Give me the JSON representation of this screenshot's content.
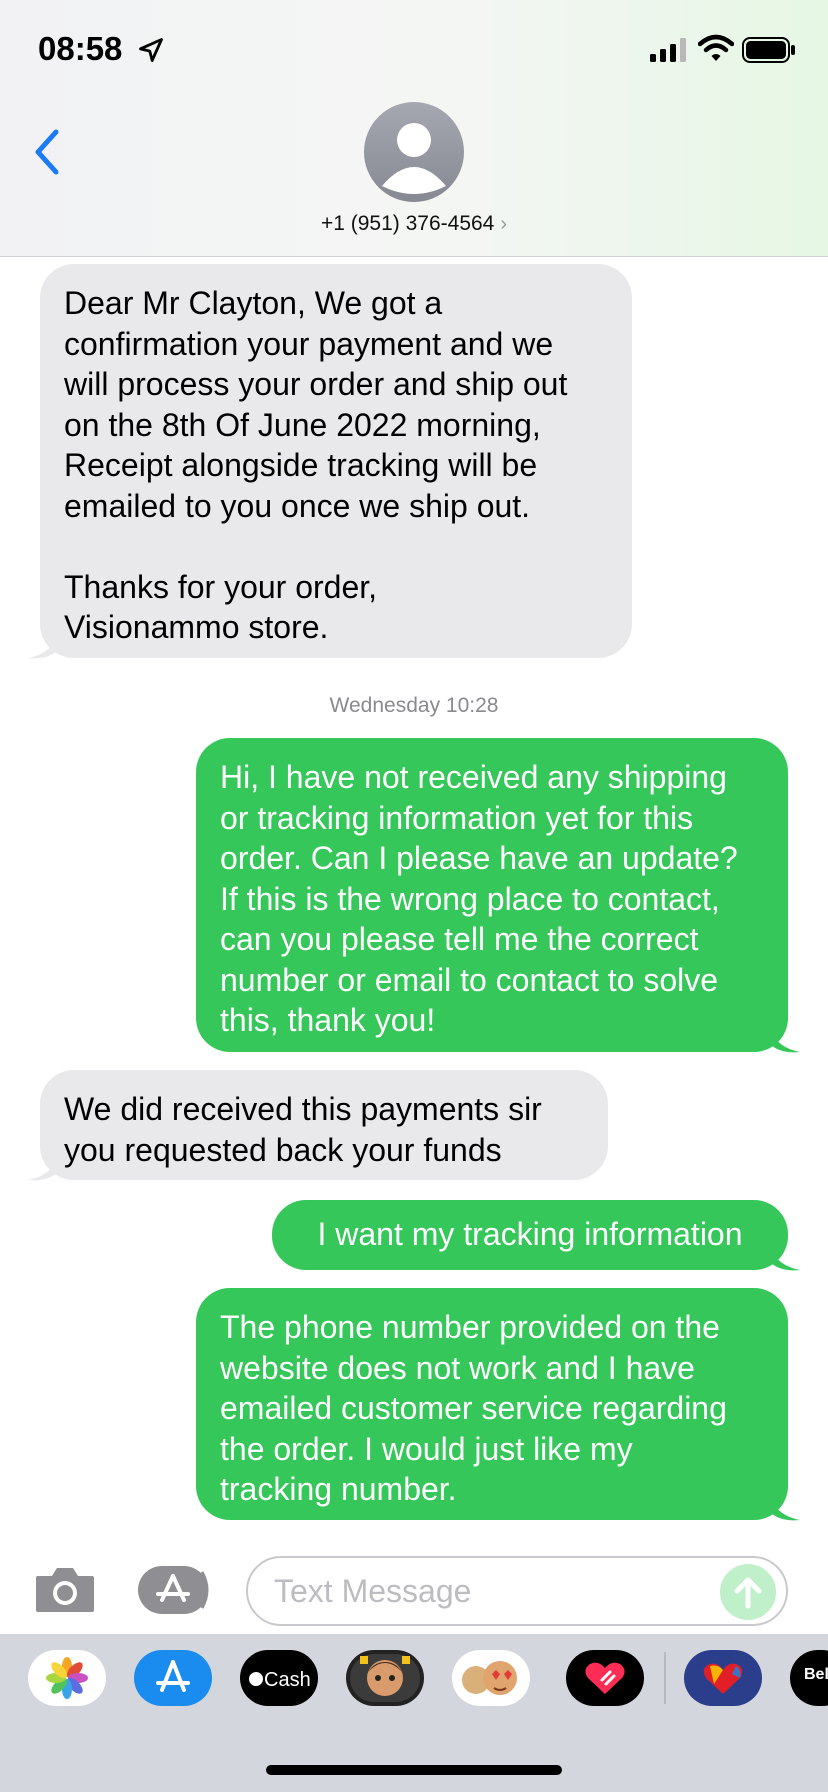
{
  "status_bar": {
    "time": "08:58"
  },
  "header": {
    "contact": "+1 (951) 376-4564",
    "chevron": "›"
  },
  "messages": [
    {
      "dir": "in",
      "text": "Dear Mr Clayton, We got a\nconfirmation your payment and we\nwill process your order and ship out\non the 8th Of June 2022 morning,\nReceipt alongside tracking will be\nemailed to you once we ship out.\n\nThanks for your order,\nVisionammo store."
    },
    {
      "dir": "out",
      "text": "Hi, I have not received any shipping\nor tracking information yet for this\norder. Can I please have an update?\nIf this is the wrong place to contact,\ncan you please tell me the correct\nnumber or email to contact to solve\nthis, thank you!"
    },
    {
      "dir": "in",
      "text": "We did received this payments sir\nyou requested back your funds"
    },
    {
      "dir": "out",
      "text": "I want my tracking information"
    },
    {
      "dir": "out",
      "text": "The phone number provided on the\nwebsite does not work and I have\nemailed customer service regarding\nthe order. I would just like my\ntracking number."
    }
  ],
  "timestamp": "Wednesday 10:28",
  "compose": {
    "placeholder": "Text Message"
  },
  "app_tray": {
    "items": [
      {
        "name": "photos-icon"
      },
      {
        "name": "app-store-icon"
      },
      {
        "name": "apple-cash-icon",
        "label": "Cash"
      },
      {
        "name": "memoji-icon"
      },
      {
        "name": "memoji-stickers-icon"
      },
      {
        "name": "digital-touch-icon"
      },
      {
        "name": "southwest-icon"
      },
      {
        "name": "partial-app-icon",
        "label": "Bel"
      }
    ]
  },
  "colors": {
    "incoming": "#e9e9eb",
    "outgoing": "#35c759",
    "accent": "#1a7bf5"
  }
}
